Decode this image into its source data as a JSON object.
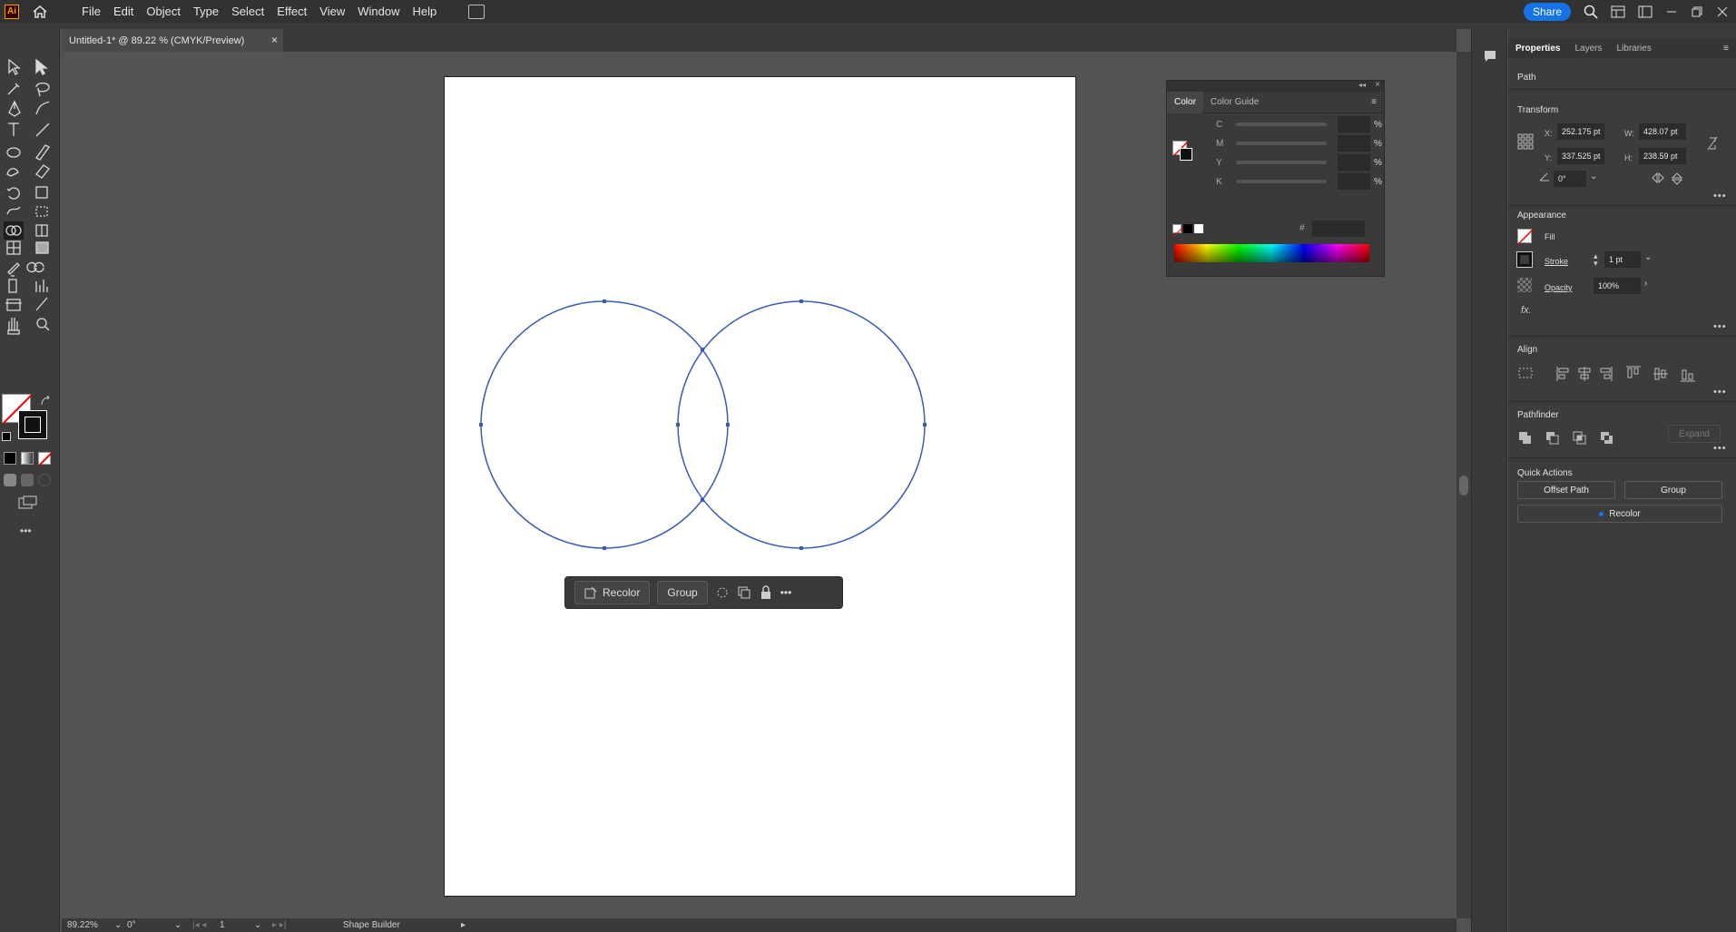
{
  "app": {
    "logo": "Ai",
    "menus": [
      "File",
      "Edit",
      "Object",
      "Type",
      "Select",
      "Effect",
      "View",
      "Window",
      "Help"
    ],
    "share_label": "Share"
  },
  "document": {
    "tab_title": "Untitled-1* @ 89.22 % (CMYK/Preview)",
    "close": "×"
  },
  "context_bar": {
    "recolor": "Recolor",
    "group": "Group"
  },
  "color_panel": {
    "tabs": [
      "Color",
      "Color Guide"
    ],
    "channels": [
      "C",
      "M",
      "Y",
      "K"
    ],
    "percent": "%",
    "hash": "#"
  },
  "properties": {
    "tabs": [
      "Properties",
      "Layers",
      "Libraries"
    ],
    "selection_type": "Path",
    "transform": {
      "title": "Transform",
      "x_label": "X:",
      "x": "252.175 pt",
      "y_label": "Y:",
      "y": "337.525 pt",
      "w_label": "W:",
      "w": "428.07 pt",
      "h_label": "H:",
      "h": "238.59 pt",
      "angle": "0°"
    },
    "appearance": {
      "title": "Appearance",
      "fill": "Fill",
      "stroke": "Stroke",
      "stroke_weight": "1 pt",
      "opacity": "Opacity",
      "opacity_value": "100%",
      "fx": "fx."
    },
    "align": {
      "title": "Align"
    },
    "pathfinder": {
      "title": "Pathfinder",
      "expand": "Expand"
    },
    "quick_actions": {
      "title": "Quick Actions",
      "offset_path": "Offset Path",
      "group": "Group",
      "recolor": "Recolor"
    }
  },
  "status": {
    "zoom": "89.22%",
    "rotation": "0°",
    "artboard": "1",
    "tool": "Shape Builder"
  },
  "colors": {
    "path_blue": "#3a5bb5",
    "accent": "#1473e6"
  }
}
